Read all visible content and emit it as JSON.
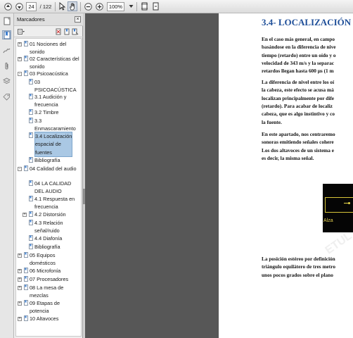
{
  "toolbar": {
    "current_page": "24",
    "total_pages": "/ 122",
    "zoom": "100%",
    "colors": {
      "background": "#e6e6e6"
    }
  },
  "rail": {
    "icons": [
      "page-thumbnails-icon",
      "bookmarks-icon",
      "signatures-icon",
      "attachments-icon",
      "layers-icon",
      "tags-icon"
    ]
  },
  "bookmarks_panel": {
    "title": "Marcadores",
    "close": "×",
    "items": [
      {
        "label_lines": [
          "01 Nociones del",
          "sonido"
        ]
      },
      {
        "label_lines": [
          "02 Características del",
          "sonido"
        ]
      },
      {
        "label_lines": [
          "03 Psicoacústica"
        ]
      },
      {
        "label_lines": [
          "03",
          "PSICOACÚSTICA"
        ]
      },
      {
        "label_lines": [
          "3.1 Audición y",
          "frecuencia"
        ]
      },
      {
        "label_lines": [
          "3.2 Timbre"
        ]
      },
      {
        "label_lines": [
          "3.3",
          "Enmascaramiento"
        ]
      },
      {
        "label_lines": [
          "3.4 Localización",
          "espacial de",
          "fuentes"
        ]
      },
      {
        "label_lines": [
          "Bibliografía"
        ]
      },
      {
        "label_lines": [
          "04 Calidad del audio"
        ]
      },
      {
        "label_lines": [
          "04 LA CALIDAD",
          "DEL AUDIO"
        ]
      },
      {
        "label_lines": [
          "4.1 Respuesta en",
          "frecuencia"
        ]
      },
      {
        "label_lines": [
          "4.2 Distorsión"
        ]
      },
      {
        "label_lines": [
          "4.3 Relación",
          "señal/ruido"
        ]
      },
      {
        "label_lines": [
          "4.4 Diafonía"
        ]
      },
      {
        "label_lines": [
          "Bibliografía"
        ]
      },
      {
        "label_lines": [
          "05 Equipos",
          "domésticos"
        ]
      },
      {
        "label_lines": [
          "06 Microfonía"
        ]
      },
      {
        "label_lines": [
          "07 Procesadores"
        ]
      },
      {
        "label_lines": [
          "08 La mesa de",
          "mezclas"
        ]
      },
      {
        "label_lines": [
          "09 Etapas de",
          "potencia"
        ]
      },
      {
        "label_lines": [
          "10 Altavoces"
        ]
      }
    ],
    "selected_index": 7,
    "selected_color": "#aac8e4"
  },
  "page": {
    "title": "3.4- LOCALIZACIÓN",
    "paragraphs": [
      [
        "En el caso más general, en campo",
        "basándose en la diferencia de nive",
        "tiempo (retardo) entre un oído y o",
        "velocidad de 343 m/s y la separac",
        "retardos llegan hasta 600 µs (1 m"
      ],
      [
        "La diferencia de nivel entre los oí",
        "la cabeza, este efecto se acusa má",
        "localizan principalmente por dife",
        "(retardo). Para acabar de localiz",
        "cabeza, que es algo instintivo y co",
        "la fuente."
      ],
      [
        "En este apartado, nos centraremo",
        "sonoras emitiendo señales cohere",
        "Los dos altavoces de un sistema e",
        "es decir, la misma señal."
      ],
      [
        "La posición estéreo por definición",
        "triángulo equilátero de tres metro",
        "unos pocos grados sobre el plano"
      ]
    ],
    "figure_caption": "Alza",
    "watermark": "ETUL",
    "title_color": "#1f4f99"
  }
}
